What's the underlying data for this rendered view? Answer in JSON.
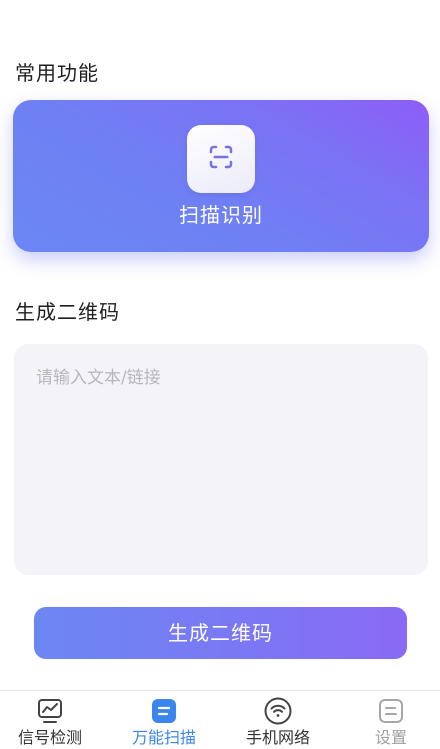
{
  "common": {
    "title": "常用功能",
    "scan_card": {
      "label": "扫描识别",
      "icon": "scan-icon"
    }
  },
  "generate": {
    "title": "生成二维码",
    "input": {
      "placeholder": "请输入文本/链接",
      "value": ""
    },
    "button_label": "生成二维码"
  },
  "tabbar": {
    "items": [
      {
        "label": "信号检测",
        "icon": "signal-chart-icon",
        "active": false,
        "muted": false
      },
      {
        "label": "万能扫描",
        "icon": "scan-tab-icon",
        "active": true,
        "muted": false
      },
      {
        "label": "手机网络",
        "icon": "wifi-icon",
        "active": false,
        "muted": false
      },
      {
        "label": "设置",
        "icon": "settings-icon",
        "active": false,
        "muted": true
      }
    ]
  },
  "colors": {
    "accent_blue": "#3b86ee",
    "gradient_start": "#6b87f4",
    "gradient_end": "#8d5df7",
    "tab_default": "#333333",
    "tab_muted": "#a0a0a0",
    "input_bg": "#f4f4f8"
  }
}
